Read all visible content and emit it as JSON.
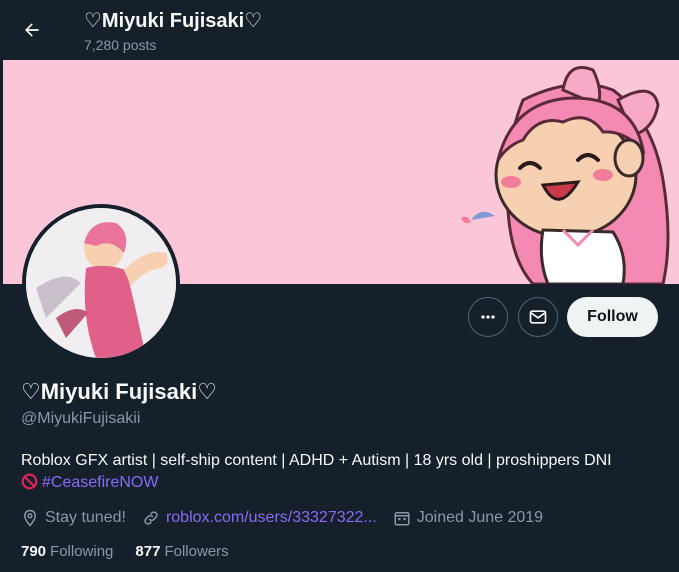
{
  "header": {
    "title": "♡Miyuki Fujisaki♡",
    "posts": "7,280 posts"
  },
  "profile": {
    "display_name": "♡Miyuki Fujisaki♡",
    "handle": "@MiyukiFujisakii",
    "bio_text": "Roblox GFX artist | self-ship content | ADHD + Autism | 18 yrs old | proshippers DNI",
    "hashtag": "#CeasefireNOW",
    "location": "Stay tuned!",
    "link": "roblox.com/users/33327322...",
    "joined": "Joined June 2019"
  },
  "stats": {
    "following_count": "790",
    "following_label": "Following",
    "followers_count": "877",
    "followers_label": "Followers"
  },
  "actions": {
    "follow_label": "Follow"
  },
  "icons": {
    "back": "arrow-left-icon",
    "more": "more-horizontal-icon",
    "message": "envelope-icon",
    "location": "location-pin-icon",
    "link": "link-icon",
    "calendar": "calendar-icon",
    "no_entry": "no-entry-icon"
  },
  "colors": {
    "background": "#15202b",
    "banner": "#fcc6d9",
    "accent_link": "#8a6bf8",
    "muted_text": "#8b98a5",
    "follow_button": "#eff3f4"
  }
}
